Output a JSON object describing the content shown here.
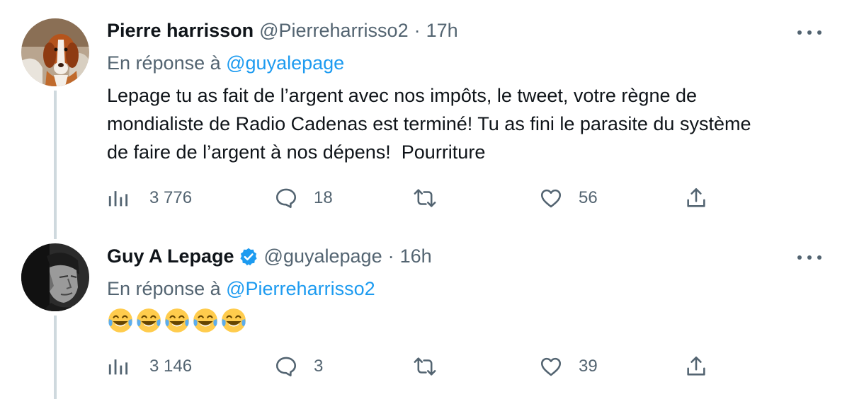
{
  "tweets": [
    {
      "author_name": "Pierre harrisson",
      "author_handle": "@Pierreharrisso2",
      "separator": "·",
      "time": "17h",
      "verified": false,
      "avatar_icon": "dog-photo-avatar",
      "reply_prefix": "En réponse à ",
      "reply_to": "@guyalepage",
      "text": "Lepage tu as fait de l’argent avec nos impôts, le tweet, votre règne de\nmondialiste de Radio Cadenas est terminé! Tu as fini le parasite du système\nde faire de l’argent à nos dépens!  Pourriture",
      "views": "3 776",
      "replies": "18",
      "retweets": "",
      "likes": "56"
    },
    {
      "author_name": "Guy A Lepage",
      "author_handle": "@guyalepage",
      "separator": "·",
      "time": "16h",
      "verified": true,
      "avatar_icon": "man-bw-photo-avatar",
      "reply_prefix": "En réponse à ",
      "reply_to": "@Pierreharrisso2",
      "emojis": [
        "😂",
        "😂",
        "😂",
        "😂",
        "😂"
      ],
      "views": "3 146",
      "replies": "3",
      "retweets": "",
      "likes": "39"
    }
  ],
  "icons": {
    "views": "bar-chart-icon",
    "reply": "speech-bubble-icon",
    "retweet": "retweet-icon",
    "like": "heart-icon",
    "share": "share-upload-icon",
    "more": "more-dots-icon",
    "verified": "verified-badge-icon"
  },
  "colors": {
    "text": "#0f1419",
    "secondary": "#536471",
    "link": "#1d9bf0",
    "thread_line": "#cfd9de"
  }
}
